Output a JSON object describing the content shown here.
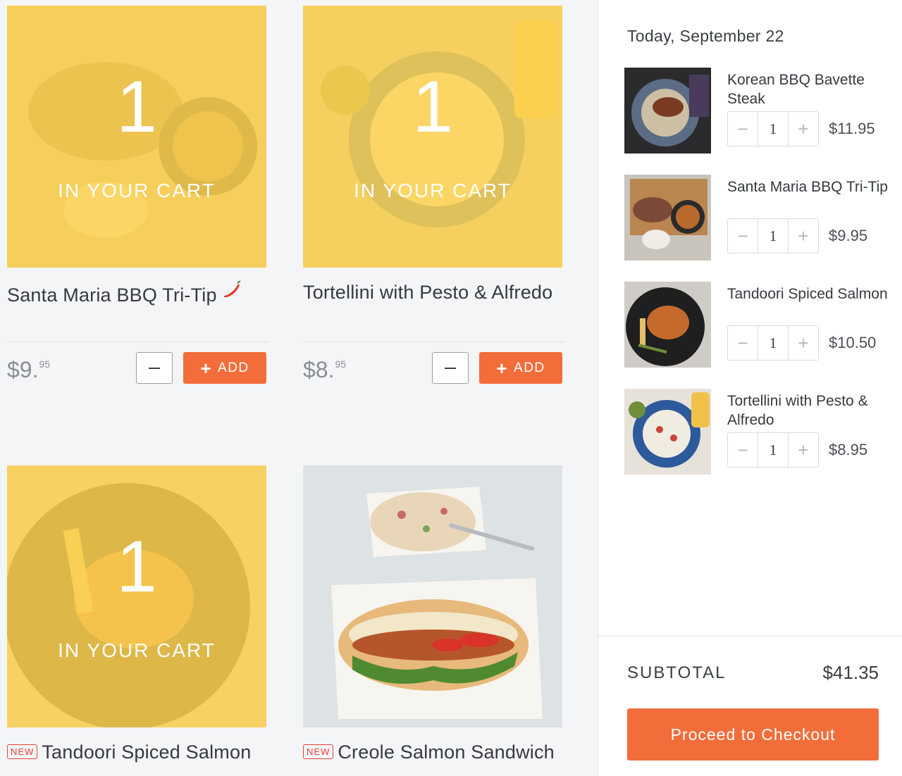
{
  "menu": {
    "cards": [
      {
        "title": "Santa Maria BBQ Tri-Tip",
        "spicy_icon": "chili-pepper-icon",
        "in_cart_qty": "1",
        "in_cart_label": "IN YOUR CART",
        "price_dollars": "$9.",
        "price_cents": "95",
        "add_label": "ADD"
      },
      {
        "title": "Tortellini with Pesto & Alfredo",
        "in_cart_qty": "1",
        "in_cart_label": "IN YOUR CART",
        "price_dollars": "$8.",
        "price_cents": "95",
        "add_label": "ADD"
      },
      {
        "badge": "NEW",
        "title": "Tandoori Spiced Salmon",
        "in_cart_qty": "1",
        "in_cart_label": "IN YOUR CART"
      },
      {
        "badge": "NEW",
        "title": "Creole Salmon Sandwich"
      }
    ]
  },
  "cart": {
    "date": "Today, September 22",
    "items": [
      {
        "name": "Korean BBQ Bavette Steak",
        "qty": "1",
        "price": "$11.95",
        "minus": "−",
        "plus": "+"
      },
      {
        "name": "Santa Maria BBQ Tri-Tip",
        "qty": "1",
        "price": "$9.95",
        "minus": "−",
        "plus": "+"
      },
      {
        "name": "Tandoori Spiced Salmon",
        "qty": "1",
        "price": "$10.50",
        "minus": "−",
        "plus": "+"
      },
      {
        "name": "Tortellini with Pesto & Alfredo",
        "qty": "1",
        "price": "$8.95",
        "minus": "−",
        "plus": "+"
      }
    ],
    "subtotal_label": "SUBTOTAL",
    "subtotal_value": "$41.35",
    "checkout_label": "Proceed to Checkout"
  },
  "colors": {
    "accent_orange": "#f26d3a",
    "overlay_yellow": "#fdd250",
    "new_badge_red": "#e8413b",
    "page_bg": "#f4f5f7"
  }
}
